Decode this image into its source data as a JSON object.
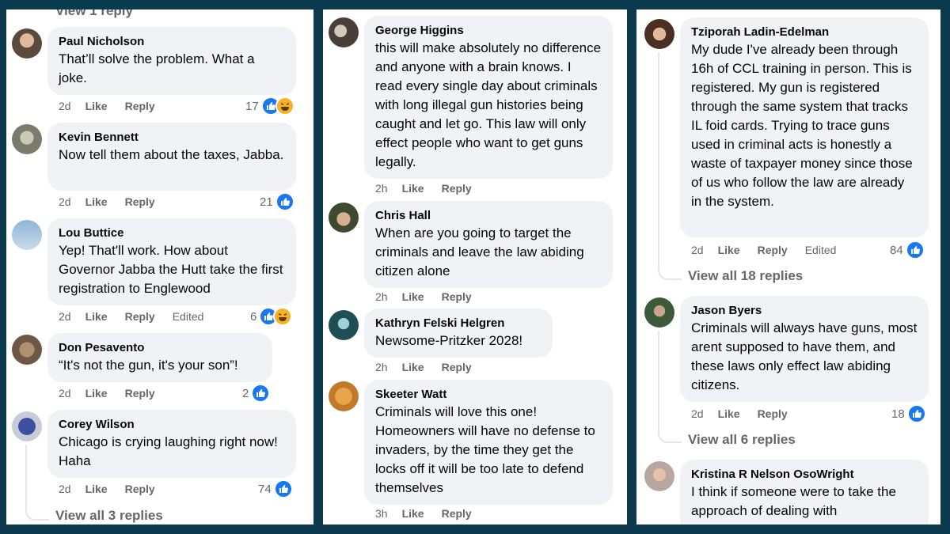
{
  "left": {
    "top_link": "View 1 reply",
    "comments": [
      {
        "author": "Paul Nicholson",
        "text": "That’ll solve the problem. What a joke.",
        "time": "2d",
        "like": "Like",
        "reply": "Reply",
        "reactions": "17"
      },
      {
        "author": "Kevin Bennett",
        "text": "Now tell them about the taxes, Jabba.",
        "time": "2d",
        "like": "Like",
        "reply": "Reply",
        "reactions": "21"
      },
      {
        "author": "Lou Buttice",
        "text": "Yep! That'll work. How about Governor Jabba the Hutt take the first registration to Englewood",
        "time": "2d",
        "like": "Like",
        "reply": "Reply",
        "edited": "Edited",
        "reactions": "6"
      },
      {
        "author": "Don Pesavento",
        "text": "“It's not the gun, it's your son”!",
        "time": "2d",
        "like": "Like",
        "reply": "Reply",
        "reactions": "2"
      },
      {
        "author": "Corey Wilson",
        "text": "Chicago is crying laughing right now! Haha",
        "time": "2d",
        "like": "Like",
        "reply": "Reply",
        "reactions": "74"
      }
    ],
    "view_replies": "View all 3 replies"
  },
  "mid": {
    "comments": [
      {
        "author": "George Higgins",
        "text": "this will make absolutely no difference and anyone with a brain knows. I read every single day about criminals with long illegal gun histories being caught and let go. This law will only effect people who want to get guns legally.",
        "time": "2h",
        "like": "Like",
        "reply": "Reply"
      },
      {
        "author": "Chris Hall",
        "text": "When are you going to target the criminals and leave the law abiding citizen alone",
        "time": "2h",
        "like": "Like",
        "reply": "Reply"
      },
      {
        "author": "Kathryn Felski Helgren",
        "text": "Newsome-Pritzker 2028!",
        "time": "2h",
        "like": "Like",
        "reply": "Reply"
      },
      {
        "author": "Skeeter Watt",
        "text": "Criminals will love this one! Homeowners will have no defense to invaders, by the time they get the locks off it will be too late to defend themselves",
        "time": "3h",
        "like": "Like",
        "reply": "Reply"
      }
    ]
  },
  "right": {
    "comments": [
      {
        "author": "Tziporah Ladin-Edelman",
        "text": "My dude I've already been through 16h of CCL training in person. This is registered. My gun is registered through the same system that tracks IL foid cards. Trying to trace guns used in criminal acts is honestly a waste of taxpayer money since those of us who follow the law are already in the system.",
        "time": "2d",
        "like": "Like",
        "reply": "Reply",
        "edited": "Edited",
        "reactions": "84"
      },
      {
        "author": "Jason Byers",
        "text": "Criminals will always have guns, most arent supposed to have them, and these laws only effect law abiding citizens.",
        "time": "2d",
        "like": "Like",
        "reply": "Reply",
        "reactions": "18"
      },
      {
        "author": "Kristina R Nelson OsoWright",
        "text": "I think if someone were to take the approach of dealing with"
      }
    ],
    "view_replies_1": "View all 18 replies",
    "view_replies_2": "View all 6 replies"
  },
  "colors": {
    "background": "#0b3a4f",
    "bubble": "#f0f2f5",
    "like_blue": "#1877f2",
    "meta_gray": "#65676b"
  }
}
